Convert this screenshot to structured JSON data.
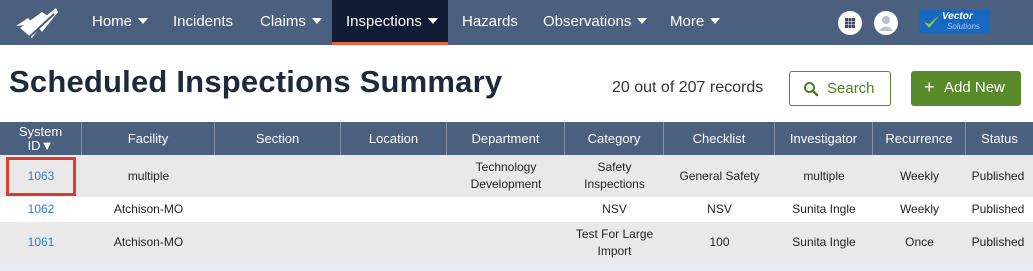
{
  "nav": {
    "items": [
      {
        "label": "Home",
        "dropdown": true
      },
      {
        "label": "Incidents",
        "dropdown": false
      },
      {
        "label": "Claims",
        "dropdown": true
      },
      {
        "label": "Inspections",
        "dropdown": true,
        "active": true
      },
      {
        "label": "Hazards",
        "dropdown": false
      },
      {
        "label": "Observations",
        "dropdown": true
      },
      {
        "label": "More",
        "dropdown": true
      }
    ],
    "icons": [
      "app-logo-icon",
      "grid-apps-icon",
      "user-avatar-icon"
    ],
    "brand": {
      "line1": "Vector",
      "line2": "Solutions"
    }
  },
  "header": {
    "title": "Scheduled Inspections Summary",
    "record_count": "20 out of 207 records",
    "search_label": "Search",
    "add_label": "Add New",
    "add_icon": "+"
  },
  "table": {
    "columns": [
      "System ID▼",
      "Facility",
      "Section",
      "Location",
      "Department",
      "Category",
      "Checklist",
      "Investigator",
      "Recurrence",
      "Status"
    ],
    "rows": [
      [
        "1063",
        "multiple",
        "",
        "",
        "Technology Development",
        "Safety Inspections",
        "General Safety",
        "multiple",
        "Weekly",
        "Published"
      ],
      [
        "1062",
        "Atchison-MO",
        "",
        "",
        "",
        "NSV",
        "NSV",
        "Sunita Ingle",
        "Weekly",
        "Published"
      ],
      [
        "1061",
        "Atchison-MO",
        "",
        "",
        "",
        "Test For Large Import",
        "100",
        "Sunita Ingle",
        "Once",
        "Published"
      ]
    ]
  },
  "colors": {
    "nav_bg": "#4b5f7e",
    "nav_active_bg": "#0f1c33",
    "nav_active_underline": "#e8643b",
    "primary_green": "#5a8a2a",
    "link_blue": "#2f7fc9",
    "highlight_red": "#e23b2b"
  }
}
